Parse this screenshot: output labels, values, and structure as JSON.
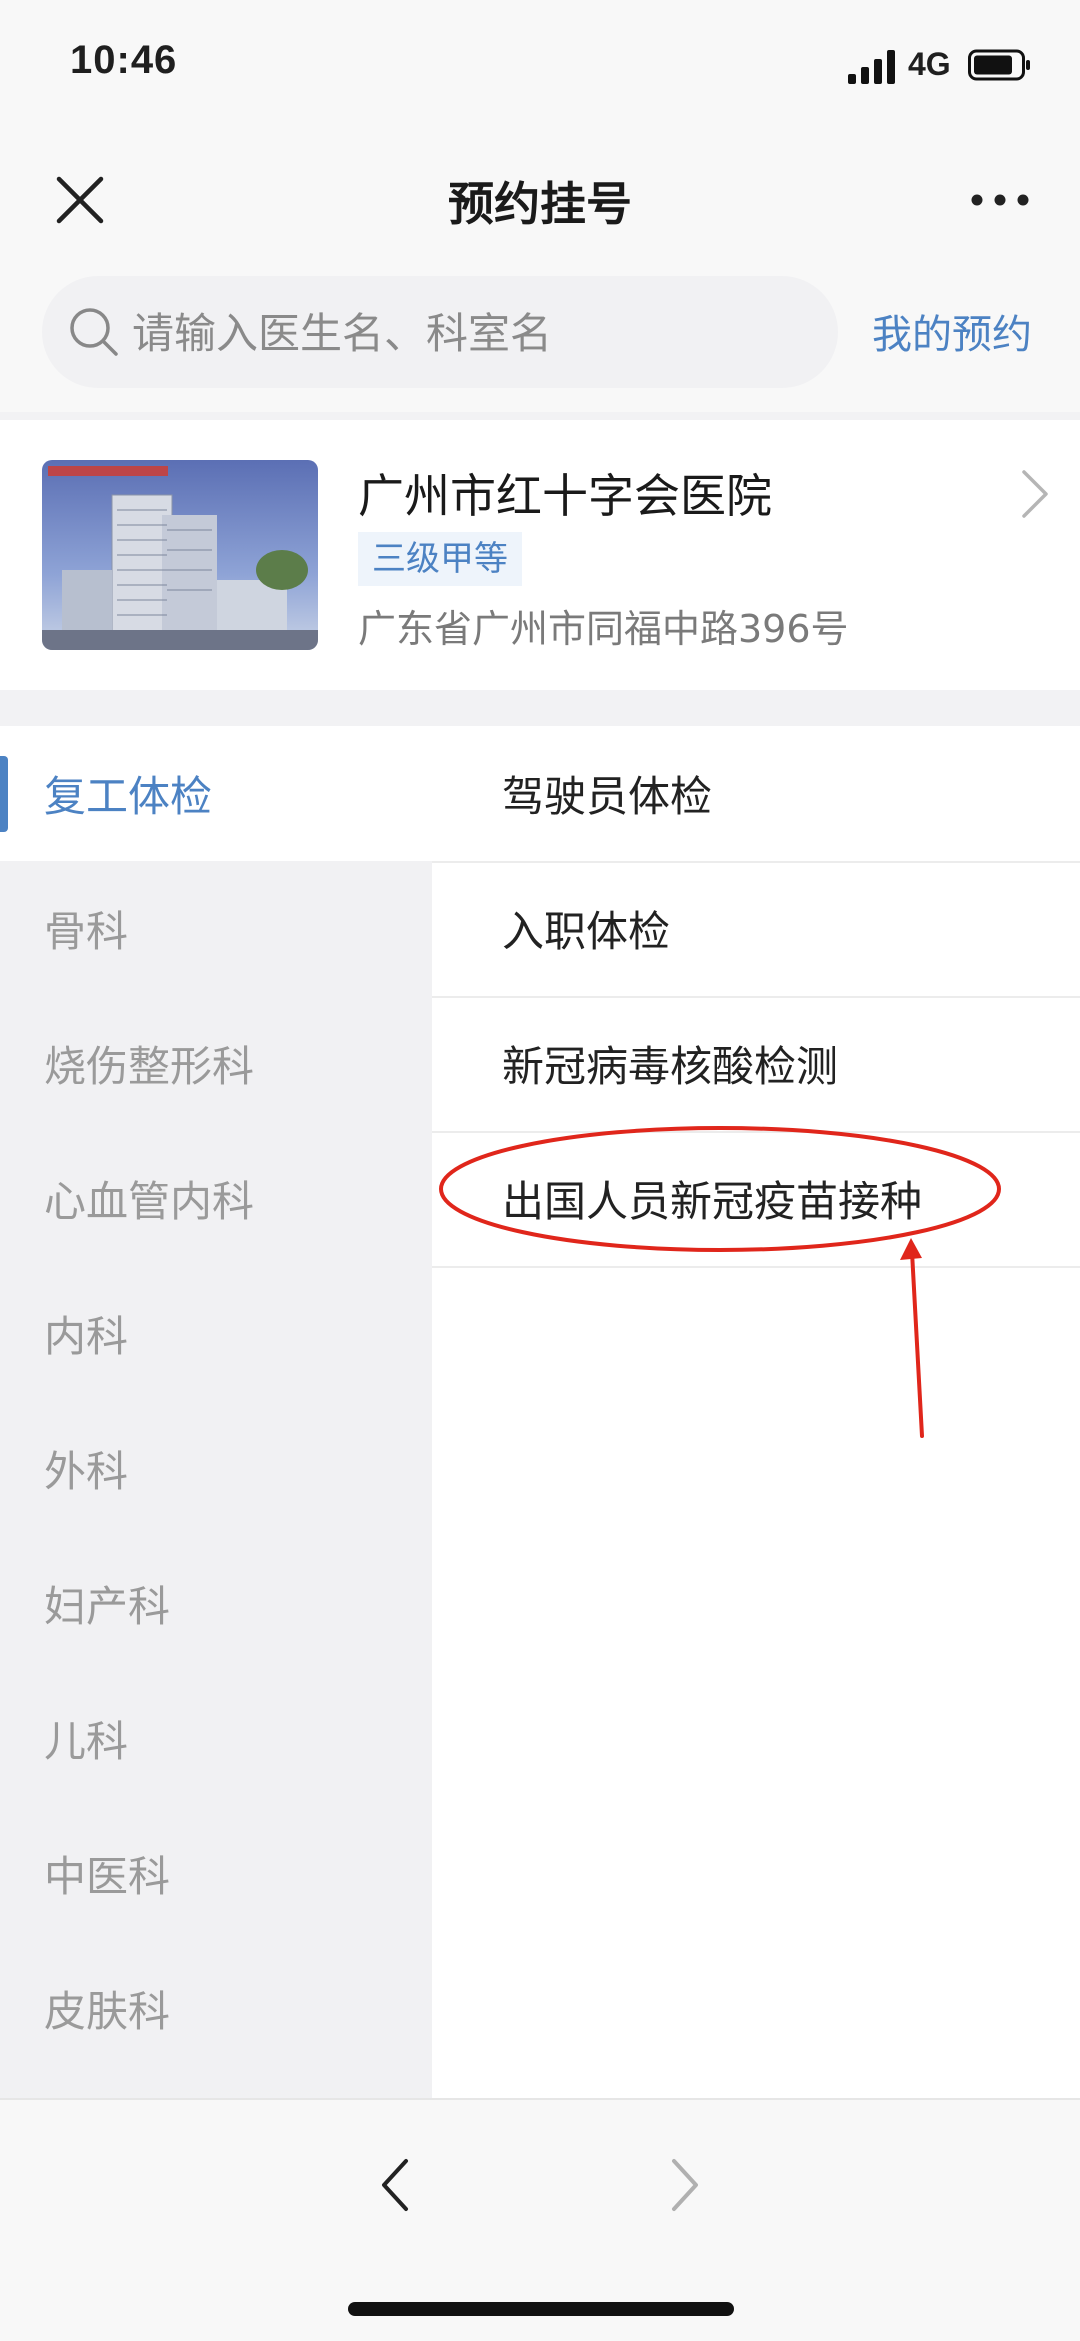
{
  "status_bar": {
    "time": "10:46",
    "network": "4G"
  },
  "nav": {
    "title": "预约挂号"
  },
  "search": {
    "placeholder": "请输入医生名、科室名",
    "my_appointments": "我的预约"
  },
  "hospital": {
    "name": "广州市红十字会医院",
    "grade": "三级甲等",
    "address": "广东省广州市同福中路396号"
  },
  "departments": [
    {
      "label": "复工体检",
      "active": true
    },
    {
      "label": "骨科"
    },
    {
      "label": "烧伤整形科"
    },
    {
      "label": "心血管内科"
    },
    {
      "label": "内科"
    },
    {
      "label": "外科"
    },
    {
      "label": "妇产科"
    },
    {
      "label": "儿科"
    },
    {
      "label": "中医科"
    },
    {
      "label": "皮肤科"
    }
  ],
  "sub_items": [
    {
      "label": "驾驶员体检"
    },
    {
      "label": "入职体检"
    },
    {
      "label": "新冠病毒核酸检测"
    },
    {
      "label": "出国人员新冠疫苗接种"
    }
  ],
  "colors": {
    "accent": "#4c82c3",
    "annotation": "#e0261b",
    "sidebar_bg": "#f1f1f3"
  },
  "icons": [
    "signal-icon",
    "battery-icon",
    "close-icon",
    "more-icon",
    "search-icon",
    "chevron-right-icon",
    "back-icon",
    "forward-icon"
  ]
}
